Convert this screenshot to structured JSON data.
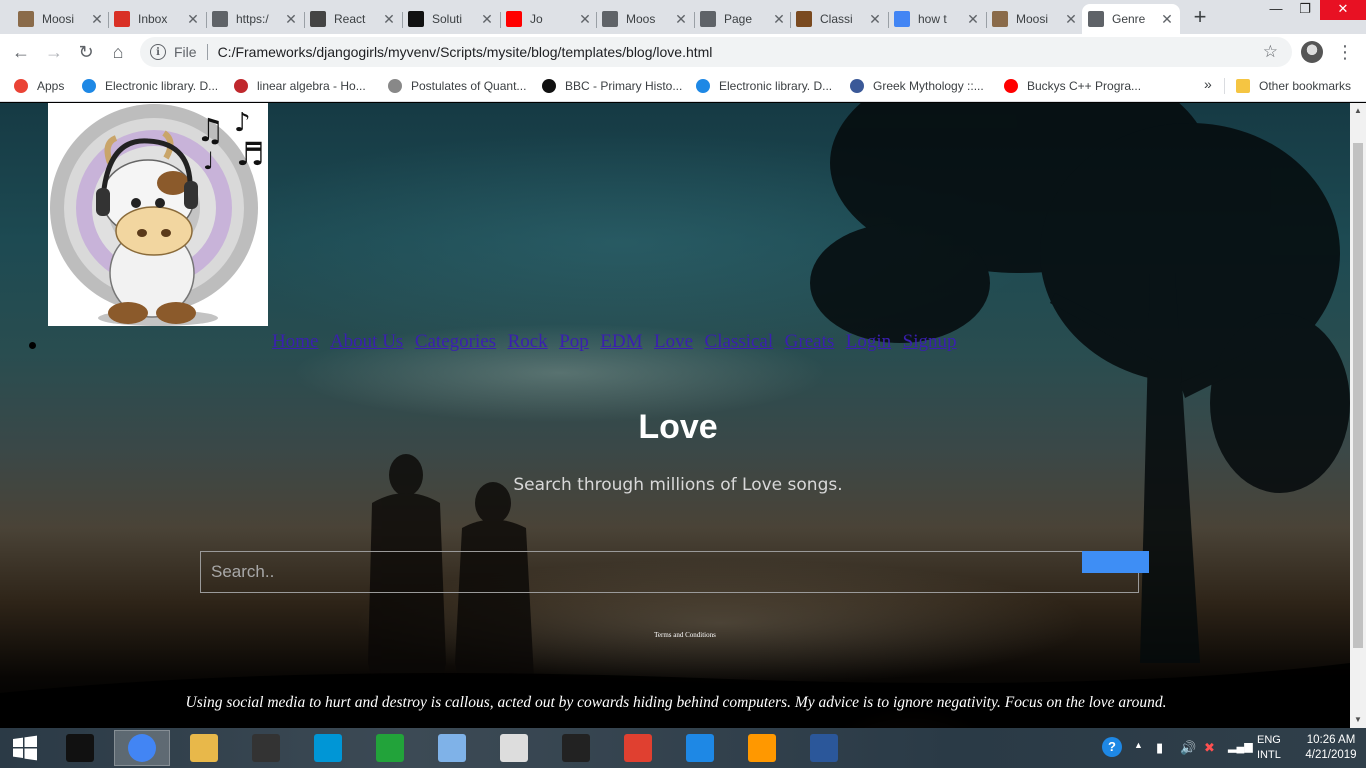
{
  "browser": {
    "tabs": [
      {
        "title": "Moosi",
        "icon": "cow-icon",
        "color": "#8a6b4a"
      },
      {
        "title": "Inbox",
        "icon": "gmail-icon",
        "color": "#d93025"
      },
      {
        "title": "https:/",
        "icon": "page-icon",
        "color": "#5f6368"
      },
      {
        "title": "React",
        "icon": "react-icon",
        "color": "#444444"
      },
      {
        "title": "Soluti",
        "icon": "s-icon",
        "color": "#111111"
      },
      {
        "title": "Jo",
        "icon": "youtube-icon",
        "color": "#ff0000"
      },
      {
        "title": "Moos",
        "icon": "page-icon",
        "color": "#5f6368"
      },
      {
        "title": "Page",
        "icon": "page-icon",
        "color": "#5f6368"
      },
      {
        "title": "Classi",
        "icon": "painting-icon",
        "color": "#7a4a20"
      },
      {
        "title": "how t",
        "icon": "google-icon",
        "color": "#4285f4"
      },
      {
        "title": "Moosi",
        "icon": "cow-icon",
        "color": "#8a6b4a"
      },
      {
        "title": "Genre",
        "icon": "page-icon",
        "color": "#5f6368"
      }
    ],
    "address": {
      "scheme_label": "File",
      "url": "C:/Frameworks/djangogirls/myvenv/Scripts/mysite/blog/templates/blog/love.html"
    },
    "bookmarks": [
      {
        "label": "Apps",
        "icon": "apps-grid-icon"
      },
      {
        "label": "Electronic library. D...",
        "icon": "globe-icon"
      },
      {
        "label": "linear algebra - Ho...",
        "icon": "flower-icon"
      },
      {
        "label": "Postulates of Quant...",
        "icon": "atom-icon"
      },
      {
        "label": "BBC - Primary Histo...",
        "icon": "bbc-icon"
      },
      {
        "label": "Electronic library. D...",
        "icon": "globe-icon"
      },
      {
        "label": "Greek Mythology ::...",
        "icon": "g-icon"
      },
      {
        "label": "Buckys C++ Progra...",
        "icon": "youtube-icon"
      }
    ],
    "bookmarks_overflow": "»",
    "other_bookmarks": "Other bookmarks"
  },
  "page": {
    "nav": [
      "Home",
      "About Us",
      "Categories",
      "Rock",
      "Pop",
      "EDM",
      "Love",
      "Classical",
      "Greats",
      "Login",
      "Signup"
    ],
    "title": "Love",
    "subtitle": "Search through millions of Love songs.",
    "search_placeholder": "Search..",
    "terms": "Terms and Conditions",
    "quote": "Using social media to hurt and destroy is callous, acted out by cowards hiding behind computers. My advice is to ignore negativity. Focus on the love around."
  },
  "taskbar": {
    "apps": [
      {
        "name": "cmd-icon",
        "color": "#111111"
      },
      {
        "name": "chrome-icon",
        "color": "#4285f4"
      },
      {
        "name": "file-explorer-icon",
        "color": "#e8b84a"
      },
      {
        "name": "colorful-app-icon",
        "color": "#333333"
      },
      {
        "name": "hp-icon",
        "color": "#0096d6"
      },
      {
        "name": "store-icon",
        "color": "#22a33a"
      },
      {
        "name": "notes-icon",
        "color": "#7fb2e8"
      },
      {
        "name": "monitor-app-icon",
        "color": "#dddddd"
      },
      {
        "name": "media-player-icon",
        "color": "#222222"
      },
      {
        "name": "windows-live-icon",
        "color": "#e04030"
      },
      {
        "name": "internet-explorer-icon",
        "color": "#1e88e5"
      },
      {
        "name": "sublime-text-icon",
        "color": "#ff9800"
      },
      {
        "name": "document-app-icon",
        "color": "#2b579a"
      }
    ],
    "lang_line1": "ENG",
    "lang_line2": "INTL",
    "time": "10:26 AM",
    "date": "4/21/2019"
  }
}
